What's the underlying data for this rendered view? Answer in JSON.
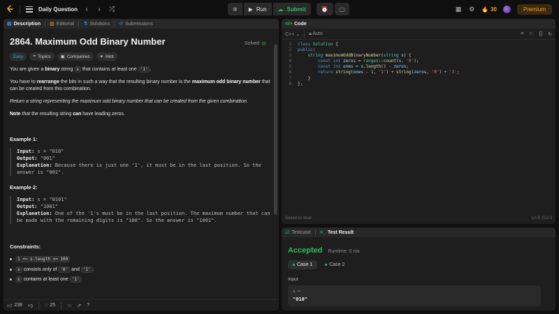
{
  "topbar": {
    "title": "Daily Question",
    "run_label": "Run",
    "submit_label": "Submit",
    "streak": "30",
    "premium_label": "Premium"
  },
  "left": {
    "tabs": [
      "Description",
      "Editorial",
      "Solutions",
      "Submissions"
    ],
    "title": "2864. Maximum Odd Binary Number",
    "solved_label": "Solved",
    "tags": [
      "Easy",
      "Topics",
      "Companies",
      "Hint"
    ],
    "p1": {
      "a": "You are given a ",
      "b": "binary",
      "c": " string ",
      "code1": "s",
      "d": " that contains at least one ",
      "code2": "'1'",
      "e": "."
    },
    "p2": {
      "a": "You have to ",
      "b": "rearrange",
      "c": " the bits in such a way that the resulting binary number is the ",
      "d": "maximum odd binary number",
      "e": " that can be created from this combination."
    },
    "p3": "Return a string representing the maximum odd binary number that can be created from the given combination.",
    "p4": {
      "a": "Note",
      "b": " that the resulting string ",
      "c": "can",
      "d": " have leading zeros."
    },
    "examples": [
      {
        "title": "Example 1:",
        "input_label": "Input:",
        "input": " s = \"010\"",
        "output_label": "Output:",
        "output": " \"001\"",
        "expl_label": "Explanation:",
        "expl": " Because there is just one '1', it must be in the last position. So the answer is \"001\"."
      },
      {
        "title": "Example 2:",
        "input_label": "Input:",
        "input": " s = \"0101\"",
        "output_label": "Output:",
        "output": " \"1001\"",
        "expl_label": "Explanation:",
        "expl": " One of the '1's must be in the last position. The maximum number that can be made with the remaining digits is \"100\". So the answer is \"1001\"."
      }
    ],
    "constraints_title": "Constraints:",
    "constraints": [
      {
        "code": "1 <= s.length <= 100",
        "text": ""
      },
      {
        "code": "s",
        "text": " consists only of ",
        "code2": "'0'",
        "text2": " and ",
        "code3": "'1'",
        "text3": "."
      },
      {
        "code": "s",
        "text": " contains at least one ",
        "code2": "'1'",
        "text2": ""
      }
    ],
    "footer": {
      "likes": "238",
      "comments": "25"
    }
  },
  "code": {
    "tab_label": "Code",
    "language": "C++",
    "mode": "Auto",
    "line_numbers": [
      "1",
      "2",
      "3",
      "4",
      "5",
      "6",
      "7",
      "8"
    ],
    "status_left": "Saved to local",
    "status_right": "Ln 8, Col 3"
  },
  "result": {
    "tabs": [
      "Testcase",
      "Test Result"
    ],
    "status": "Accepted",
    "runtime": "Runtime: 0 ms",
    "cases": [
      "Case 1",
      "Case 2"
    ],
    "input_label": "Input",
    "input_key": "s =",
    "input_value": "\"010\""
  },
  "colors": {
    "accent": "#ffa116",
    "accepted": "#2cbb5d",
    "easy": "#1cbaba"
  }
}
